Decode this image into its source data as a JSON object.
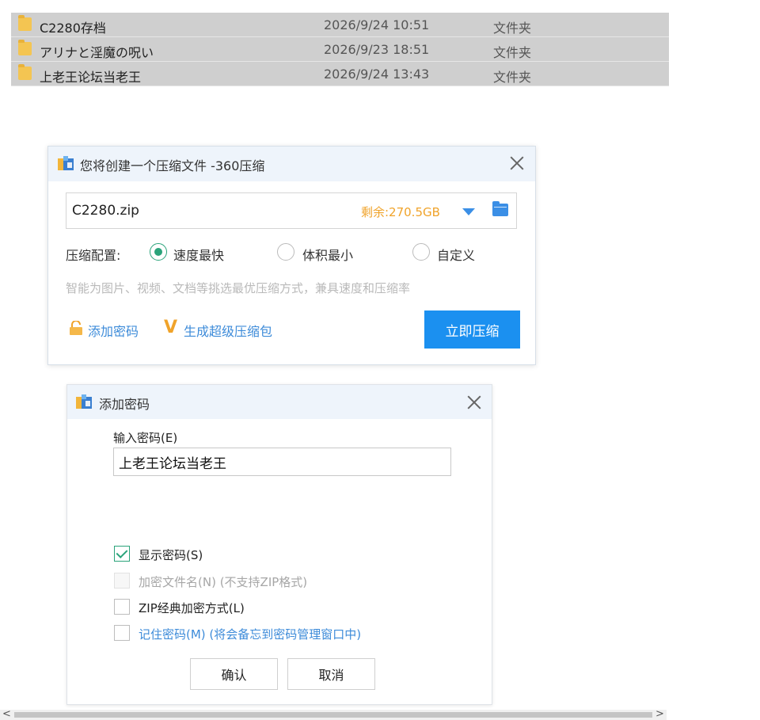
{
  "files": [
    {
      "name": "C2280存档",
      "date": "2026/9/24 10:51",
      "type": "文件夹"
    },
    {
      "name": "アリナと淫魔の呪い",
      "date": "2026/9/23 18:51",
      "type": "文件夹"
    },
    {
      "name": "上老王论坛当老王",
      "date": "2026/9/24 13:43",
      "type": "文件夹"
    }
  ],
  "compress_dialog": {
    "title": "您将创建一个压缩文件 -360压缩",
    "filename": "C2280.zip",
    "free_space": "剩余:270.5GB",
    "config_label": "压缩配置:",
    "options": [
      "速度最快",
      "体积最小",
      "自定义"
    ],
    "selected_option": "速度最快",
    "hint": "智能为图片、视频、文档等挑选最优压缩方式，兼具速度和压缩率",
    "add_password_link": "添加密码",
    "super_pack_link": "生成超级压缩包",
    "compress_button": "立即压缩"
  },
  "password_dialog": {
    "title": "添加密码",
    "input_label": "输入密码(E)",
    "password_value": "上老王论坛当老王",
    "checkboxes": [
      {
        "label": "显示密码(S)",
        "checked": true,
        "enabled": true
      },
      {
        "label": "加密文件名(N) (不支持ZIP格式)",
        "checked": false,
        "enabled": false
      },
      {
        "label": "ZIP经典加密方式(L)",
        "checked": false,
        "enabled": true
      },
      {
        "label": "记住密码(M) (将会备忘到密码管理窗口中)",
        "checked": false,
        "enabled": true
      }
    ],
    "ok_button": "确认",
    "cancel_button": "取消"
  },
  "scrollbar": {
    "left_arrow": "<",
    "right_arrow": ">"
  },
  "colors": {
    "accent_blue": "#1b90f0",
    "link_blue": "#3d8bd9",
    "free_space_orange": "#f0a32a",
    "check_green": "#2aa37a",
    "folder_yellow": "#f4c552",
    "row_selected": "#cfcfcf"
  }
}
